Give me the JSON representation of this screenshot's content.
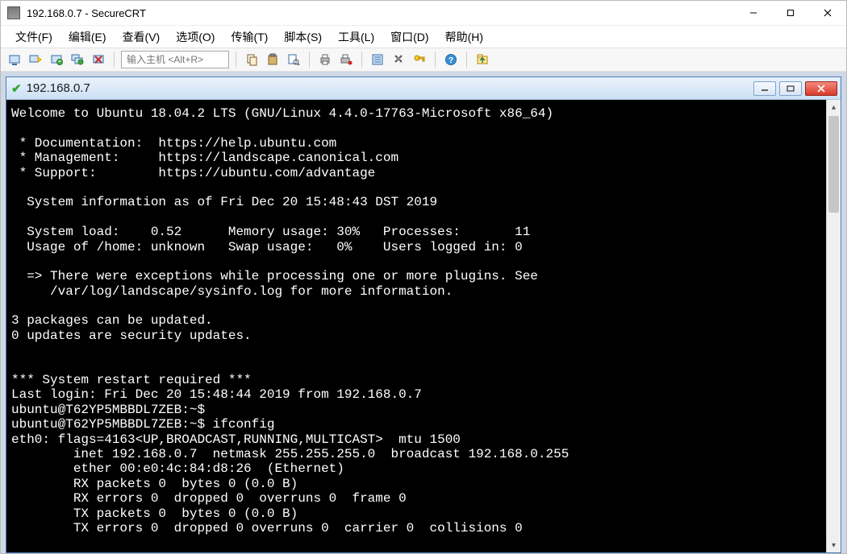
{
  "window": {
    "title": "192.168.0.7 - SecureCRT"
  },
  "menu": {
    "file": "文件(F)",
    "edit": "编辑(E)",
    "view": "查看(V)",
    "options": "选项(O)",
    "transfer": "传输(T)",
    "script": "脚本(S)",
    "tools": "工具(L)",
    "window": "窗口(D)",
    "help": "帮助(H)"
  },
  "toolbar": {
    "host_placeholder": "输入主机 <Alt+R>"
  },
  "mdi": {
    "title": "192.168.0.7"
  },
  "terminal_lines": [
    "Welcome to Ubuntu 18.04.2 LTS (GNU/Linux 4.4.0-17763-Microsoft x86_64)",
    "",
    " * Documentation:  https://help.ubuntu.com",
    " * Management:     https://landscape.canonical.com",
    " * Support:        https://ubuntu.com/advantage",
    "",
    "  System information as of Fri Dec 20 15:48:43 DST 2019",
    "",
    "  System load:    0.52      Memory usage: 30%   Processes:       11",
    "  Usage of /home: unknown   Swap usage:   0%    Users logged in: 0",
    "",
    "  => There were exceptions while processing one or more plugins. See",
    "     /var/log/landscape/sysinfo.log for more information.",
    "",
    "3 packages can be updated.",
    "0 updates are security updates.",
    "",
    "",
    "*** System restart required ***",
    "Last login: Fri Dec 20 15:48:44 2019 from 192.168.0.7",
    "ubuntu@T62YP5MBBDL7ZEB:~$",
    "ubuntu@T62YP5MBBDL7ZEB:~$ ifconfig",
    "eth0: flags=4163<UP,BROADCAST,RUNNING,MULTICAST>  mtu 1500",
    "        inet 192.168.0.7  netmask 255.255.255.0  broadcast 192.168.0.255",
    "        ether 00:e0:4c:84:d8:26  (Ethernet)",
    "        RX packets 0  bytes 0 (0.0 B)",
    "        RX errors 0  dropped 0  overruns 0  frame 0",
    "        TX packets 0  bytes 0 (0.0 B)",
    "        TX errors 0  dropped 0 overruns 0  carrier 0  collisions 0"
  ]
}
